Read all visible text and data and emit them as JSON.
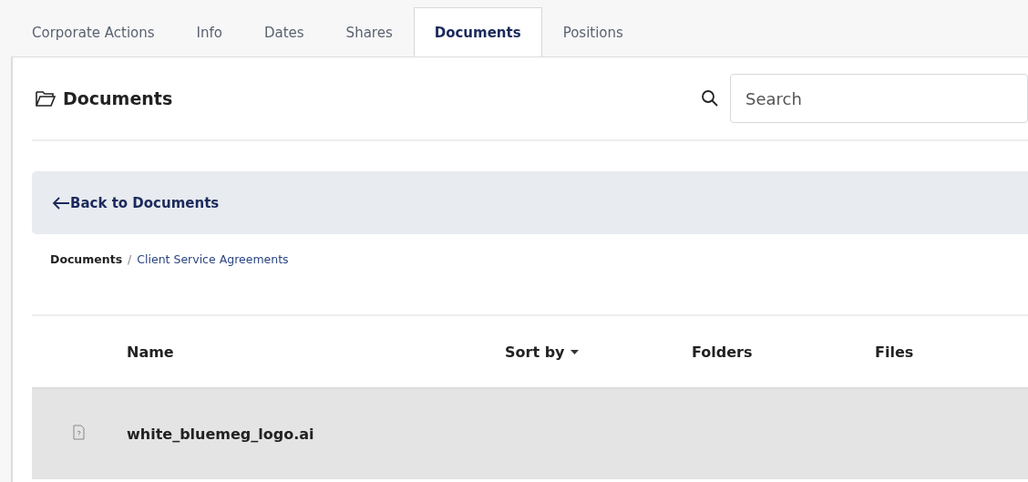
{
  "tabs": [
    {
      "label": "Corporate Actions",
      "selected": false
    },
    {
      "label": "Info",
      "selected": false
    },
    {
      "label": "Dates",
      "selected": false
    },
    {
      "label": "Shares",
      "selected": false
    },
    {
      "label": "Documents",
      "selected": true
    },
    {
      "label": "Positions",
      "selected": false
    }
  ],
  "panel": {
    "title": "Documents",
    "search": {
      "placeholder": "Search"
    },
    "back_link": "Back to Documents",
    "breadcrumb": [
      {
        "label": "Documents",
        "current": false
      },
      {
        "label": "Client Service Agreements",
        "current": true
      }
    ],
    "breadcrumb_separator": "/",
    "table": {
      "columns": [
        "Name",
        "Sort by",
        "Folders",
        "Files"
      ],
      "rows": [
        {
          "name": "white_bluemeg_logo.ai",
          "selected": true
        }
      ]
    }
  }
}
